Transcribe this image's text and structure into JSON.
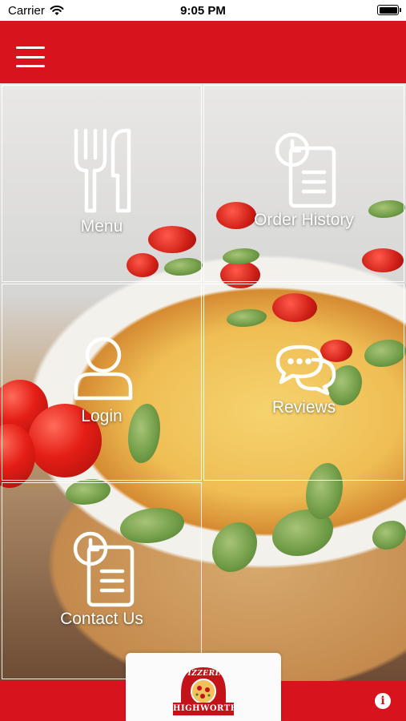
{
  "status_bar": {
    "carrier": "Carrier",
    "time": "9:05 PM"
  },
  "header": {
    "menu_icon": "hamburger-icon"
  },
  "tiles": [
    {
      "label": "Menu",
      "icon": "fork-knife-icon"
    },
    {
      "label": "Order History",
      "icon": "clock-document-icon"
    },
    {
      "label": "Login",
      "icon": "user-icon"
    },
    {
      "label": "Reviews",
      "icon": "chat-bubbles-icon"
    },
    {
      "label": "Contact Us",
      "icon": "clock-document-icon"
    }
  ],
  "footer": {
    "logo_top": "PIZZERIA",
    "logo_bottom": "HIGHWORTH",
    "info_label": "i"
  },
  "colors": {
    "brand_red": "#d7141d",
    "tile_border": "#ffffff"
  }
}
